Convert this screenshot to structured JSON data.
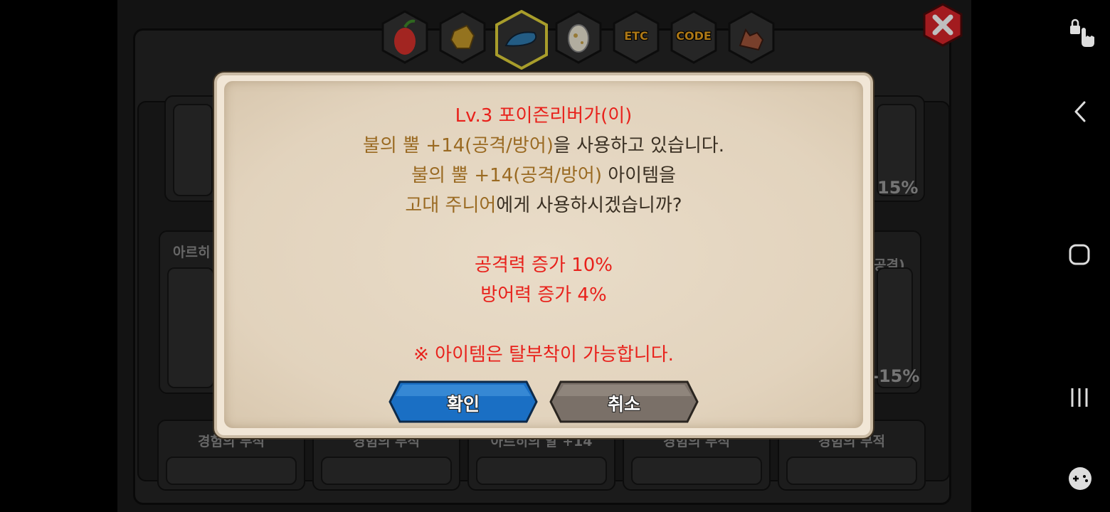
{
  "tabs": [
    {
      "icon": "fruit-icon",
      "label": ""
    },
    {
      "icon": "ore-icon",
      "label": ""
    },
    {
      "icon": "dragon-head-icon",
      "label": "",
      "active": true
    },
    {
      "icon": "egg-icon",
      "label": ""
    },
    {
      "icon": "etc-icon",
      "label": "ETC"
    },
    {
      "icon": "code-icon",
      "label": "CODE"
    },
    {
      "icon": "wolf-icon",
      "label": ""
    }
  ],
  "background": {
    "row2_left_name": "아르히",
    "row2_right_name": "공격)",
    "row1_right_pct": "15%",
    "row2_right_pct": "-15%",
    "bottom_items": [
      "경험의 부적",
      "경험의 부적",
      "아르히의 알 +14",
      "경험의 부적",
      "경험의 부적"
    ]
  },
  "dialog": {
    "line1": "Lv.3 포이즌리버가(이)",
    "line2_item": "불의 뿔 +14(공격/방어)",
    "line2_rest": "을 사용하고 있습니다.",
    "line3_item": "불의 뿔 +14(공격/방어)",
    "line3_rest": " 아이템을",
    "line4_target": "고대 주니어",
    "line4_rest": "에게 사용하시겠습니까?",
    "stat1": "공격력 증가 10%",
    "stat2": "방어력 증가 4%",
    "note": "※ 아이템은 탈부착이 가능합니다.",
    "confirm_label": "확인",
    "cancel_label": "취소"
  },
  "colors": {
    "red": "#e8211b",
    "gold": "#9a6a22",
    "confirm_blue": "#1a6fc4",
    "cancel_gray": "#7a7068",
    "close_red": "#d8242a"
  },
  "navbar": [
    "touch-lock-icon",
    "back-icon",
    "home-icon",
    "recents-icon",
    "game-tools-icon"
  ]
}
